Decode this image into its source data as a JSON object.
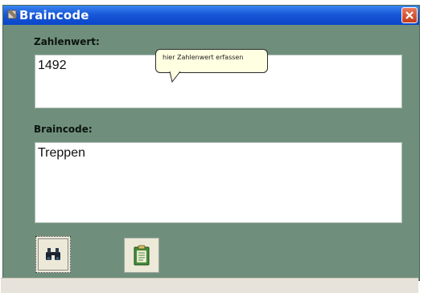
{
  "window": {
    "title": "Braincode"
  },
  "fields": {
    "zahlenwert": {
      "label": "Zahlenwert:",
      "value": "1492"
    },
    "braincode": {
      "label": "Braincode:",
      "value": "Treppen"
    }
  },
  "tooltip": {
    "text": "hier Zahlenwert erfassen"
  },
  "toolbar": [
    {
      "icon": "binoculars-icon"
    },
    {
      "icon": "clipboard-icon"
    }
  ],
  "colors": {
    "window_bg": "#6f8f7c",
    "titlebar": "#1858d8",
    "tooltip_bg": "#ffffe1"
  }
}
